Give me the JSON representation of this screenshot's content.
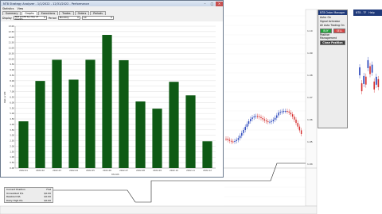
{
  "window": {
    "title": "NT8 Strategy Analyzer - 1/1/2022 - 12/31/2022 - Performance",
    "menu": [
      "Statistics",
      "View"
    ],
    "tabs": [
      "Summary",
      "Graphs",
      "Executions",
      "Trades",
      "Orders",
      "Periods"
    ],
    "active_tab": "Graphs",
    "filters": {
      "display_label": "Display",
      "display_value": "Net profit by day of month",
      "period_label": "Period",
      "period_value": "Monthly",
      "mode_value": "All"
    }
  },
  "chart_data": {
    "type": "bar",
    "categories": [
      "2022-01",
      "2022-02",
      "2022-03",
      "2022-04",
      "2022-05",
      "2022-06",
      "2022-07",
      "2022-08",
      "2022-09",
      "2022-10",
      "2022-11",
      "2022-12"
    ],
    "values": [
      4.28,
      7.98,
      9.92,
      8.1,
      9.92,
      12.2,
      9.88,
      6.1,
      5.44,
      7.9,
      6.66,
      2.45
    ],
    "ylim": [
      0,
      13
    ],
    "yticks": [
      "0.00",
      "0.50",
      "1.00",
      "1.50",
      "2.00",
      "2.50",
      "3.00",
      "3.50",
      "4.00",
      "4.50",
      "5.00",
      "5.50",
      "6.00",
      "6.50",
      "7.00",
      "7.50",
      "8.00",
      "8.50",
      "9.00",
      "9.50",
      "10.00",
      "10.50",
      "11.00",
      "11.50",
      "12.00",
      "12.50",
      "13.00"
    ],
    "xlabel": "Month",
    "ylabel": "Net profit",
    "color": "#0e5a14",
    "grid": true
  },
  "trading": {
    "chart_tabs": [
      "NT8 - TF",
      "Help"
    ],
    "panel_title": "NT8 Order Manager",
    "panel_sub": "Auto: On",
    "labels": [
      "Signal Activator",
      "All Auto Trading On"
    ],
    "buttons": [
      "BUY",
      "SELL",
      "Close Position"
    ],
    "mgmt_title": "Position Management",
    "price_labels": [
      "1.10",
      "1.09",
      "1.08",
      "1.07",
      "1.06",
      "1.05",
      "1.04"
    ]
  },
  "stats": [
    {
      "label": "Current Position",
      "value": "Flat"
    },
    {
      "label": "Unrealized P/L",
      "value": "$0.00"
    },
    {
      "label": "Realized P/L",
      "value": "$0.00"
    },
    {
      "label": "Daily High P/L",
      "value": "$0.00"
    }
  ],
  "colors": {
    "bar": "#0e5a14",
    "grid": "#d6d6d6",
    "candle_up": "#1f3db8",
    "candle_down": "#d42a2a",
    "button_buy": "#21a33a",
    "button_sell": "#d64545",
    "flat_button": "#3c3c3c"
  }
}
